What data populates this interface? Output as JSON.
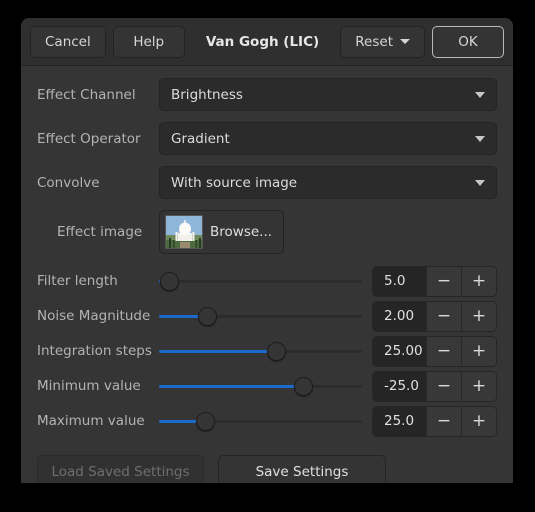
{
  "dialog": {
    "title": "Van Gogh (LIC)",
    "accent_color": "#1b6acb",
    "background_color": "#353535"
  },
  "header": {
    "cancel_label": "Cancel",
    "help_label": "Help",
    "reset_label": "Reset",
    "ok_label": "OK"
  },
  "combos": [
    {
      "label": "Effect Channel",
      "value": "Brightness"
    },
    {
      "label": "Effect Operator",
      "value": "Gradient"
    },
    {
      "label": "Convolve",
      "value": "With source image"
    }
  ],
  "effect_image": {
    "label": "Effect image",
    "button_label": "Browse...",
    "thumbnail_alt": "taj-mahal-thumbnail"
  },
  "sliders": [
    {
      "label": "Filter length",
      "value": "5.0",
      "percent": 5,
      "minus": "−",
      "plus": "+"
    },
    {
      "label": "Noise Magnitude",
      "value": "2.00",
      "percent": 24,
      "minus": "−",
      "plus": "+"
    },
    {
      "label": "Integration steps",
      "value": "25.00",
      "percent": 58,
      "minus": "−",
      "plus": "+"
    },
    {
      "label": "Minimum value",
      "value": "-25.0",
      "percent": 71,
      "minus": "−",
      "plus": "+"
    },
    {
      "label": "Maximum value",
      "value": "25.0",
      "percent": 23,
      "minus": "−",
      "plus": "+"
    }
  ],
  "footer": {
    "load_label": "Load Saved Settings",
    "load_disabled": true,
    "save_label": "Save Settings"
  }
}
